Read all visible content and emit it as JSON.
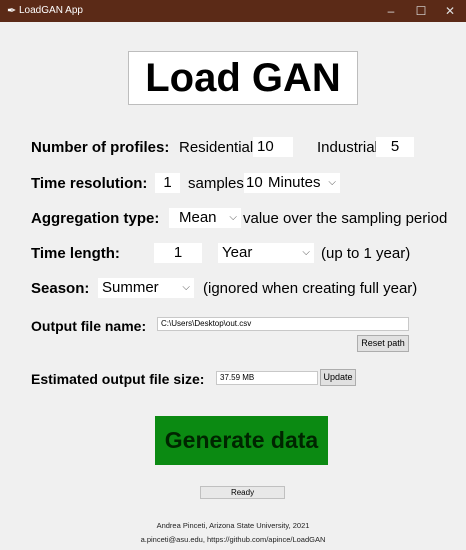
{
  "window": {
    "title": "LoadGAN App",
    "minimize": "–",
    "maximize": "☐",
    "close": "✕"
  },
  "banner": "Load GAN",
  "profiles": {
    "label": "Number of profiles:",
    "residential_label": "Residential",
    "residential_value": "10",
    "industrial_label": "Industrial",
    "industrial_value": "5"
  },
  "time_resolution": {
    "label": "Time resolution:",
    "samples_value": "1",
    "samples_label": "samples /",
    "interval_value": "10",
    "unit_value": "Minutes"
  },
  "aggregation": {
    "label": "Aggregation type:",
    "value": "Mean",
    "suffix": "value over the sampling period"
  },
  "time_length": {
    "label": "Time length:",
    "value": "1",
    "unit_value": "Year",
    "suffix": "(up to 1 year)"
  },
  "season": {
    "label": "Season:",
    "value": "Summer",
    "suffix": "(ignored when creating full year)"
  },
  "output_file": {
    "label": "Output file name:",
    "value": "C:\\Users\\Desktop\\out.csv",
    "reset_label": "Reset path"
  },
  "estimate": {
    "label": "Estimated output file size:",
    "value": "37.59 MB",
    "update_label": "Update"
  },
  "generate_label": "Generate data",
  "status_text": "Ready",
  "footer": {
    "line1": "Andrea Pinceti, Arizona State University, 2021",
    "line2": "a.pinceti@asu.edu, https://github.com/apince/LoadGAN"
  },
  "colors": {
    "titlebar": "#5b2a17",
    "window_bg": "#f0f0f0",
    "generate_button": "#0b8a12"
  }
}
